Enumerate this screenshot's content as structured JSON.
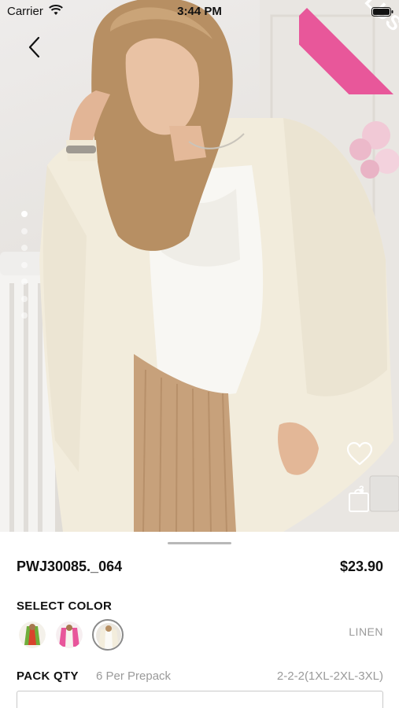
{
  "status_bar": {
    "carrier": "Carrier",
    "time": "3:44 PM"
  },
  "hero": {
    "ribbon_text": "PLUS+",
    "ribbon_color": "#e8579a",
    "image_count": 7,
    "active_index": 0,
    "cart_count": "3"
  },
  "product": {
    "sku": "PWJ30085._064",
    "price": "$23.90",
    "select_color_label": "SELECT COLOR",
    "selected_color": "LINEN",
    "swatches": [
      {
        "name": "green",
        "color": "#6fae3a"
      },
      {
        "name": "pink",
        "color": "#e8559b"
      },
      {
        "name": "linen",
        "color": "#efe9dc"
      }
    ],
    "pack_qty_label": "PACK QTY",
    "pack_qty_value": "6 Per Prepack",
    "size_range": "2-2-2(1XL-2XL-3XL)"
  }
}
